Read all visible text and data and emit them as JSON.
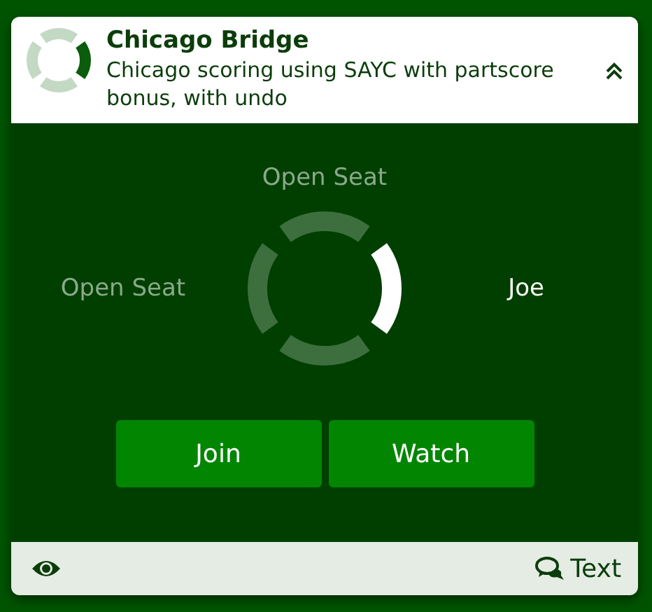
{
  "game": {
    "title": "Chicago Bridge",
    "description": "Chicago scoring using SAYC with partscore bonus, with undo"
  },
  "seats": [
    {
      "kind": "north",
      "name": "Open Seat",
      "occupied": false
    },
    {
      "kind": "east",
      "name": "Joe",
      "occupied": true
    },
    {
      "kind": "south",
      "occupied": false
    },
    {
      "kind": "west",
      "name": "Open Seat",
      "occupied": false
    }
  ],
  "buttons": [
    "Join",
    "Watch"
  ],
  "footer": {
    "chat_label": "Text"
  }
}
